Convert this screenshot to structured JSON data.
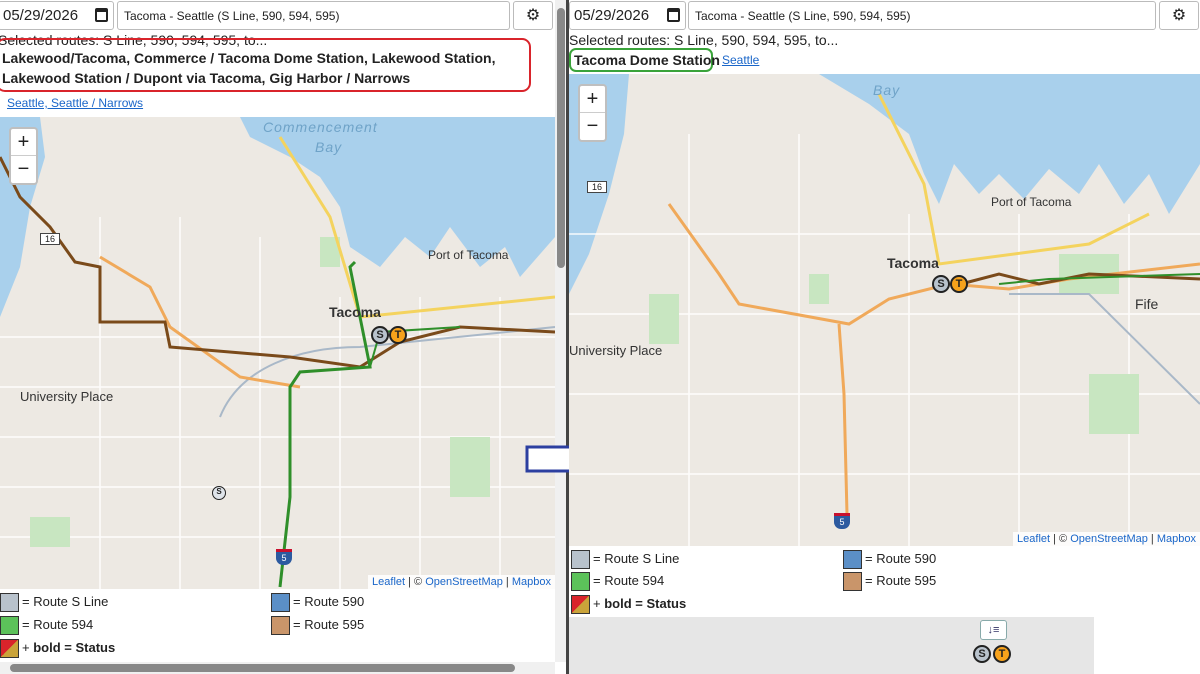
{
  "left": {
    "date": "05/29/2026",
    "route_select": "Tacoma - Seattle (S Line, 590, 594, 595)",
    "selected_routes": "Selected routes: S Line, 590, 594, 595, to...",
    "destinations": "Lakewood/Tacoma, Commerce / Tacoma Dome Station, Lakewood Station, Lakewood Station / Dupont via Tacoma, Gig Harbor / Narrows",
    "direction_link": "Seattle, Seattle / Narrows",
    "map": {
      "water_label_1": "Commencement",
      "water_label_2": "Bay",
      "city": "Tacoma",
      "place_1": "University Place",
      "place_2": "Port of Tacoma",
      "highway_16": "16",
      "highway_5": "5",
      "zoom_in": "+",
      "zoom_out": "−"
    },
    "attribution": {
      "leaflet": "Leaflet",
      "sep1": " | © ",
      "osm": "OpenStreetMap",
      "sep2": " | ",
      "mapbox": "Mapbox"
    }
  },
  "right": {
    "date": "05/29/2026",
    "route_select": "Tacoma - Seattle (S Line, 590, 594, 595)",
    "selected_routes": "Selected routes: S Line, 590, 594, 595, to...",
    "destination": "Tacoma Dome Station",
    "direction_link": "Seattle",
    "map": {
      "water_label": "Bay",
      "city": "Tacoma",
      "place_1": "University Place",
      "place_2": "Port of Tacoma",
      "place_3": "Fife",
      "highway_16": "16",
      "highway_5": "5",
      "zoom_in": "+",
      "zoom_out": "−"
    },
    "attribution": {
      "leaflet": "Leaflet",
      "sep1": " | © ",
      "osm": "OpenStreetMap",
      "sep2": " | ",
      "mapbox": "Mapbox"
    },
    "sort_icon_label": "↓≡"
  },
  "legend": {
    "s_line": "= Route S Line",
    "r590": "= Route 590",
    "r594": "= Route 594",
    "r595": "= Route 595",
    "status_prefix": "+ ",
    "status": "bold = Status"
  },
  "markers": {
    "s": "S",
    "t": "T"
  },
  "colors": {
    "s_line": "#b8c2cc",
    "r590": "#5b8fc7",
    "r594": "#5cc25a",
    "r595": "#c9956a",
    "route_brown": "#7a4a1a",
    "route_green": "#2f8f2a",
    "highlight_red": "#d9242b",
    "highlight_green": "#3aa33a",
    "water": "#a9d0ec"
  }
}
